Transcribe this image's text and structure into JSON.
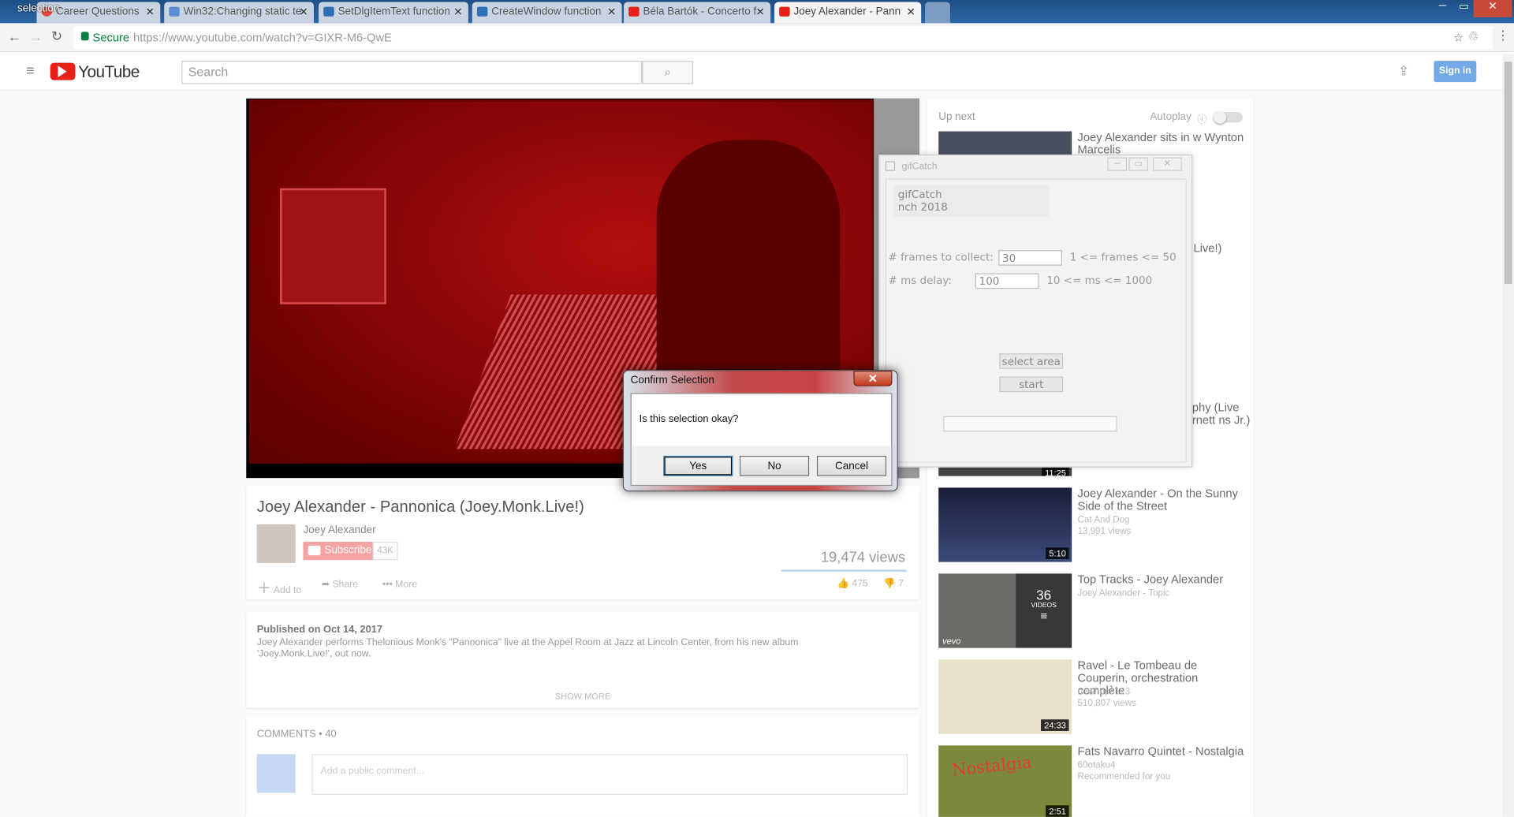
{
  "window": {
    "title": "selection",
    "controls": [
      "─",
      "▭",
      "✕"
    ]
  },
  "tabs": [
    {
      "label": "Career Questions",
      "color": "#e34a3c"
    },
    {
      "label": "Win32:Changing static te",
      "color": "#5a8fd6"
    },
    {
      "label": "SetDlgItemText function",
      "color": "#2f6fb5"
    },
    {
      "label": "CreateWindow function",
      "color": "#2f6fb5"
    },
    {
      "label": "Béla Bartók - Concerto f",
      "color": "#e62117"
    },
    {
      "label": "Joey Alexander - Pann",
      "color": "#e62117"
    }
  ],
  "address": {
    "secure": "Secure",
    "url": "https://www.youtube.com/watch?v=GIXR-M6-QwE"
  },
  "youtube": {
    "logo": "YouTube",
    "search_placeholder": "Search",
    "signin": "Sign in"
  },
  "video": {
    "title": "Joey Alexander - Pannonica (Joey.Monk.Live!)",
    "channel": "Joey Alexander",
    "subscribe": "Subscribe",
    "subs": "43K",
    "views": "19,474 views",
    "add_to": "Add to",
    "share": "Share",
    "more": "More",
    "likes": "475",
    "dislikes": "7",
    "published": "Published on Oct 14, 2017",
    "description": "Joey Alexander performs Thelonious Monk's \"Pannonica\" live at the Appel Room at Jazz at Lincoln Center, from his new album 'Joey.Monk.Live!', out now.",
    "show_more": "SHOW MORE",
    "comments": "COMMENTS • 40",
    "comment_placeholder": "Add a public comment..."
  },
  "upnext": {
    "label": "Up next",
    "autoplay": "Autoplay",
    "items": [
      {
        "title": "Joey Alexander sits in w Wynton Marcelis",
        "sub1": "",
        "sub2": "",
        "duration": ""
      },
      {
        "title": "Live!)",
        "sub1": "",
        "sub2": "",
        "duration": ""
      },
      {
        "title": "ophy (Live arnett ns Jr.)",
        "sub1": "",
        "sub2": "",
        "duration": "11:25"
      },
      {
        "title": "Joey Alexander - On the Sunny Side of the Street",
        "sub1": "Cat And Dog",
        "sub2": "13,991 views",
        "duration": "5:10"
      },
      {
        "title": "Top Tracks - Joey Alexander",
        "sub1": "Joey Alexander - Topic",
        "sub2": "",
        "duration": "",
        "playlist_count": "36",
        "playlist_label": "VIDEOS",
        "badge": "vevo"
      },
      {
        "title": "Ravel - Le Tombeau de Couperin, orchestration complète",
        "sub1": "newhope123",
        "sub2": "510,807 views",
        "duration": "24:33"
      },
      {
        "title": "Fats Navarro Quintet - Nostalgia",
        "sub1": "60otaku4",
        "sub2": "Recommended for you",
        "duration": "2:51",
        "thumb_text": "Nostalgia"
      }
    ]
  },
  "gifcatch": {
    "title": "gifCatch",
    "header_line1": "gifCatch",
    "header_line2": "nch 2018",
    "frames_label": "# frames to collect:",
    "frames_value": "30",
    "frames_hint": "1 <= frames <= 50",
    "delay_label": "# ms delay:",
    "delay_value": "100",
    "delay_hint": "10 <= ms <= 1000",
    "select_area": "select area",
    "start": "start"
  },
  "dialog": {
    "title": "Confirm Selection",
    "message": "Is this selection okay?",
    "yes": "Yes",
    "no": "No",
    "cancel": "Cancel",
    "close": "✕"
  }
}
